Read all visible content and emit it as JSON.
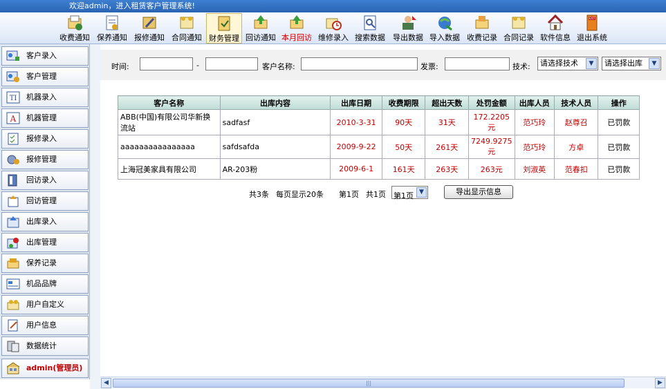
{
  "banner": {
    "welcome": "欢迎admin，进入租赁客户管理系统!"
  },
  "toolbar": [
    {
      "label": "收费通知",
      "icon": "fee-notice-icon"
    },
    {
      "label": "保养通知",
      "icon": "maintenance-notice-icon"
    },
    {
      "label": "报修通知",
      "icon": "repair-notice-icon"
    },
    {
      "label": "合同通知",
      "icon": "contract-notice-icon"
    },
    {
      "label": "财务管理",
      "icon": "finance-icon"
    },
    {
      "label": "回访通知",
      "icon": "callback-notice-icon"
    },
    {
      "label": "本月回访",
      "icon": "month-callback-icon"
    },
    {
      "label": "维修录入",
      "icon": "repair-entry-icon"
    },
    {
      "label": "搜索数据",
      "icon": "search-data-icon"
    },
    {
      "label": "导出数据",
      "icon": "export-data-icon"
    },
    {
      "label": "导入数据",
      "icon": "import-data-icon"
    },
    {
      "label": "收费记录",
      "icon": "fee-record-icon"
    },
    {
      "label": "合同记录",
      "icon": "contract-record-icon"
    },
    {
      "label": "软件信息",
      "icon": "home-icon"
    },
    {
      "label": "退出系统",
      "icon": "exit-icon"
    }
  ],
  "sidebar": [
    {
      "label": "客户录入",
      "icon": "customer-add-icon"
    },
    {
      "label": "客户管理",
      "icon": "customer-manage-icon"
    },
    {
      "label": "机器录入",
      "icon": "machine-add-icon"
    },
    {
      "label": "机器管理",
      "icon": "machine-manage-icon"
    },
    {
      "label": "报修录入",
      "icon": "repair-add-icon"
    },
    {
      "label": "报修管理",
      "icon": "repair-manage-icon"
    },
    {
      "label": "回访录入",
      "icon": "callback-add-icon"
    },
    {
      "label": "回访管理",
      "icon": "callback-manage-icon"
    },
    {
      "label": "出库录入",
      "icon": "outbound-add-icon"
    },
    {
      "label": "出库管理",
      "icon": "outbound-manage-icon"
    },
    {
      "label": "保养记录",
      "icon": "maintenance-record-icon"
    },
    {
      "label": "机品品牌",
      "icon": "brand-icon"
    },
    {
      "label": "用户自定义",
      "icon": "custom-icon"
    },
    {
      "label": "用户信息",
      "icon": "user-info-icon"
    },
    {
      "label": "数据统计",
      "icon": "statistics-icon"
    },
    {
      "label": "admin(管理员)",
      "icon": "admin-icon"
    }
  ],
  "filter": {
    "time_label": "时间:",
    "dash": "-",
    "customer_label": "客户名称:",
    "invoice_label": "发票:",
    "tech_label": "技术:",
    "tech_select": "请选择技术",
    "outbound_select": "请选择出库"
  },
  "table": {
    "headers": [
      "客户名称",
      "出库内容",
      "出库日期",
      "收费期限",
      "超出天数",
      "处罚金额",
      "出库人员",
      "技术人员",
      "操作"
    ],
    "rows": [
      [
        "ABB(中国)有限公司华新换流站",
        "sadfasf",
        "2010-3-31",
        "90天",
        "31天",
        "172.2205元",
        "范巧玲",
        "赵尊召",
        "已罚款"
      ],
      [
        "aaaaaaaaaaaaaaaa",
        "safdsafda",
        "2009-9-22",
        "50天",
        "261天",
        "7249.9275元",
        "范巧玲",
        "方卓",
        "已罚款"
      ],
      [
        "上海冠美家具有限公司",
        "AR-203粉",
        "2009-6-1",
        "161天",
        "263天",
        "263元",
        "刘淑英",
        "范春扣",
        "已罚款"
      ]
    ]
  },
  "pager": {
    "total": "共3条",
    "per_page": "每页显示20条",
    "current": "第1页",
    "pages": "共1页",
    "select": "第1页",
    "export_button": "导出显示信息"
  }
}
